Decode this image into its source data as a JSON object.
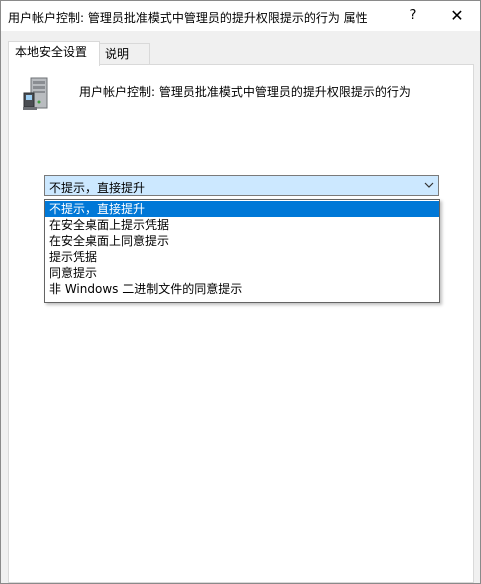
{
  "window": {
    "title": "用户帐户控制: 管理员批准模式中管理员的提升权限提示的行为 属性",
    "help_label": "?",
    "close_label": "✕"
  },
  "tabs": [
    {
      "label": "本地安全设置",
      "active": true
    },
    {
      "label": "说明",
      "active": false
    }
  ],
  "policy": {
    "icon": "server-computer-icon",
    "title": "用户帐户控制: 管理员批准模式中管理员的提升权限提示的行为"
  },
  "dropdown": {
    "selected": "不提示，直接提升",
    "options": [
      "不提示，直接提升",
      "在安全桌面上提示凭据",
      "在安全桌面上同意提示",
      "提示凭据",
      "同意提示",
      "非 Windows 二进制文件的同意提示"
    ],
    "highlighted_index": 0
  },
  "colors": {
    "highlight": "#0078d7",
    "combo_bg": "#cce8ff"
  }
}
